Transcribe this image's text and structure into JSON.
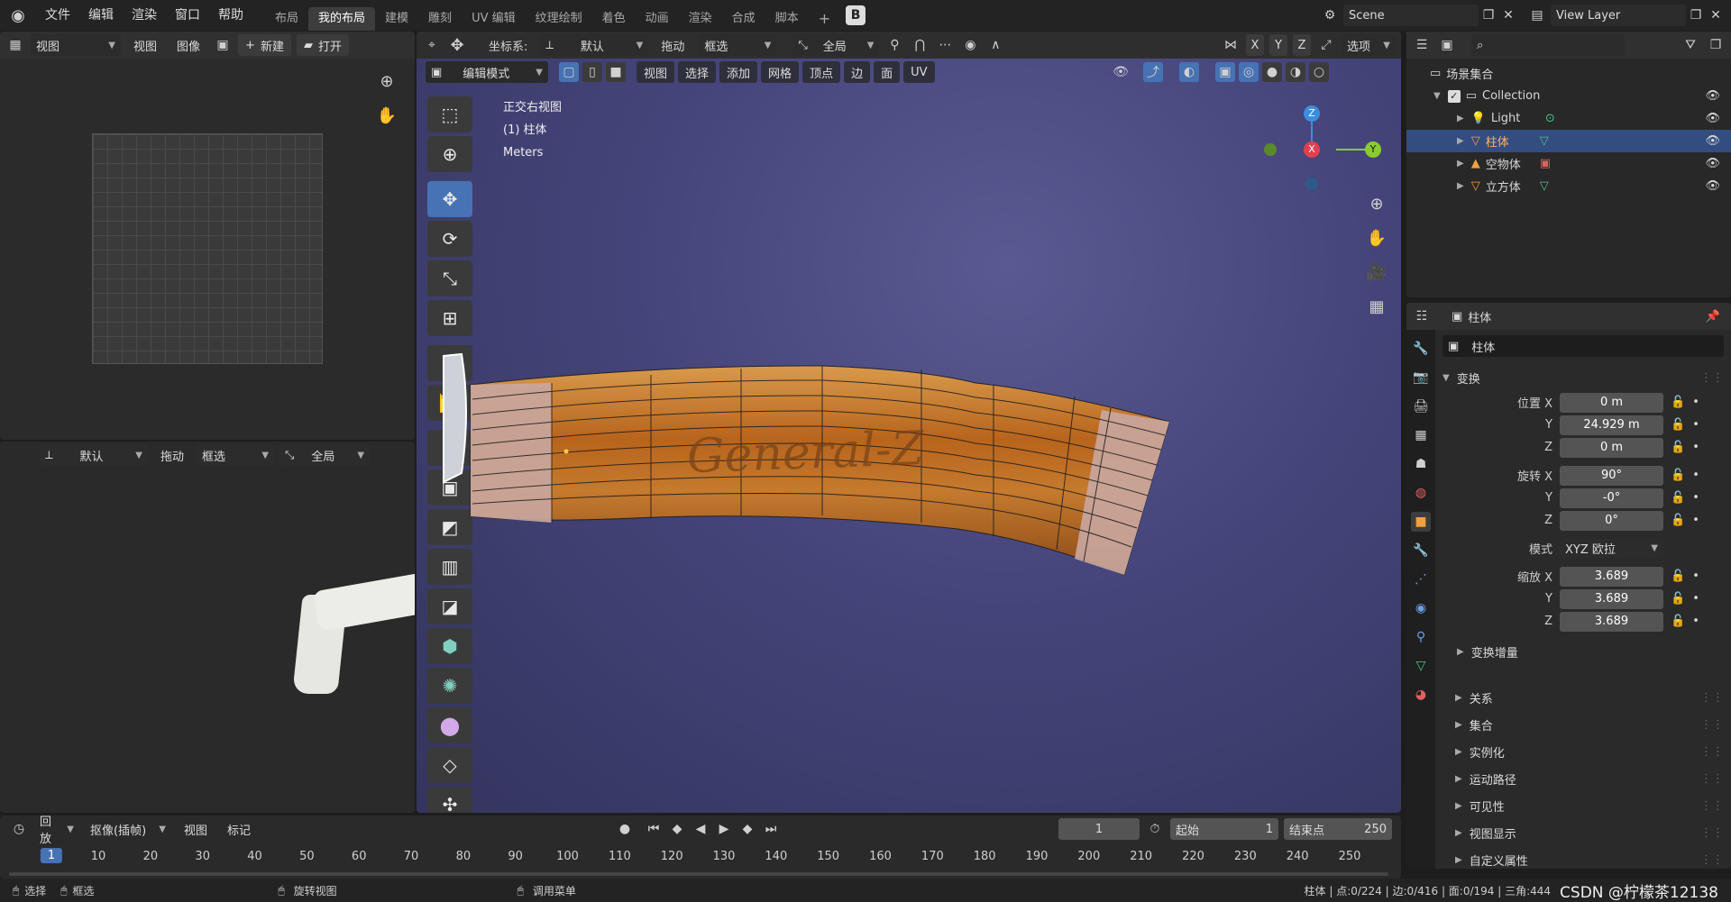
{
  "topbar": {
    "menus": [
      "文件",
      "编辑",
      "渲染",
      "窗口",
      "帮助"
    ],
    "tabs": [
      {
        "label": "布局",
        "active": false
      },
      {
        "label": "我的布局",
        "active": true
      },
      {
        "label": "建模",
        "active": false
      },
      {
        "label": "雕刻",
        "active": false
      },
      {
        "label": "UV 编辑",
        "active": false
      },
      {
        "label": "纹理绘制",
        "active": false
      },
      {
        "label": "着色",
        "active": false
      },
      {
        "label": "动画",
        "active": false
      },
      {
        "label": "渲染",
        "active": false
      },
      {
        "label": "合成",
        "active": false
      },
      {
        "label": "脚本",
        "active": false
      }
    ],
    "add_tab": "+",
    "scene": "Scene",
    "view_layer": "View Layer"
  },
  "image_editor": {
    "view_label": "视图",
    "menu_view": "视图",
    "menu_image": "图像",
    "new_label": "新建",
    "open_label": "打开"
  },
  "left_lower": {
    "orientation": "默认",
    "drag_label": "拖动",
    "select_mode": "框选",
    "pivot": "全局"
  },
  "viewport_header": {
    "coord_label": "坐标系:",
    "orientation": "默认",
    "drag_label": "拖动",
    "select_mode": "框选",
    "pivot": "全局",
    "axes": [
      "X",
      "Y",
      "Z"
    ],
    "options": "选项",
    "edit_mode": "编辑模式",
    "menus": [
      "视图",
      "选择",
      "添加",
      "网格",
      "顶点",
      "边",
      "面",
      "UV"
    ]
  },
  "viewport": {
    "view_name": "正交右视图",
    "object_name": "(1) 柱体",
    "units": "Meters",
    "engraving": "General-Z",
    "gizmo": {
      "x": "X",
      "y": "Y",
      "z": "Z"
    }
  },
  "outliner": {
    "root": "场景集合",
    "collection": "Collection",
    "items": [
      {
        "name": "Light",
        "selected": false
      },
      {
        "name": "柱体",
        "selected": true
      },
      {
        "name": "空物体",
        "selected": false
      },
      {
        "name": "立方体",
        "selected": false
      }
    ]
  },
  "properties": {
    "header_object": "柱体",
    "object_name": "柱体",
    "transform_label": "变换",
    "location": {
      "label_x": "位置 X",
      "x": "0 m",
      "y": "24.929 m",
      "z": "0 m"
    },
    "rotation": {
      "label_x": "旋转 X",
      "x": "90°",
      "y": "-0°",
      "z": "0°"
    },
    "mode_label": "模式",
    "mode": "XYZ 欧拉",
    "scale": {
      "label_x": "缩放 X",
      "x": "3.689",
      "y": "3.689",
      "z": "3.689"
    },
    "axis_y": "Y",
    "axis_z": "Z",
    "delta_label": "变换增量",
    "sections": [
      "关系",
      "集合",
      "实例化",
      "运动路径",
      "可见性",
      "视图显示",
      "自定义属性"
    ]
  },
  "timeline": {
    "playback": "回放",
    "keying": "抠像(插帧)",
    "view": "视图",
    "marker": "标记",
    "current_frame": "1",
    "start_label": "起始",
    "start": "1",
    "end_label": "结束点",
    "end": "250",
    "ticks": [
      "1",
      "10",
      "20",
      "30",
      "40",
      "50",
      "60",
      "70",
      "80",
      "90",
      "100",
      "110",
      "120",
      "130",
      "140",
      "150",
      "160",
      "170",
      "180",
      "190",
      "200",
      "210",
      "220",
      "230",
      "240",
      "250"
    ]
  },
  "statusbar": {
    "select": "选择",
    "box_select": "框选",
    "rotate_view": "旋转视图",
    "call_menu": "调用菜单",
    "stats": "柱体 | 点:0/224 | 边:0/416 | 面:0/194 | 三角:444",
    "watermark": "CSDN @柠檬茶12138"
  },
  "colors": {
    "accent": "#4772b3",
    "viewport_bg": "#3a3a6a",
    "wood": "#c87a2a"
  }
}
